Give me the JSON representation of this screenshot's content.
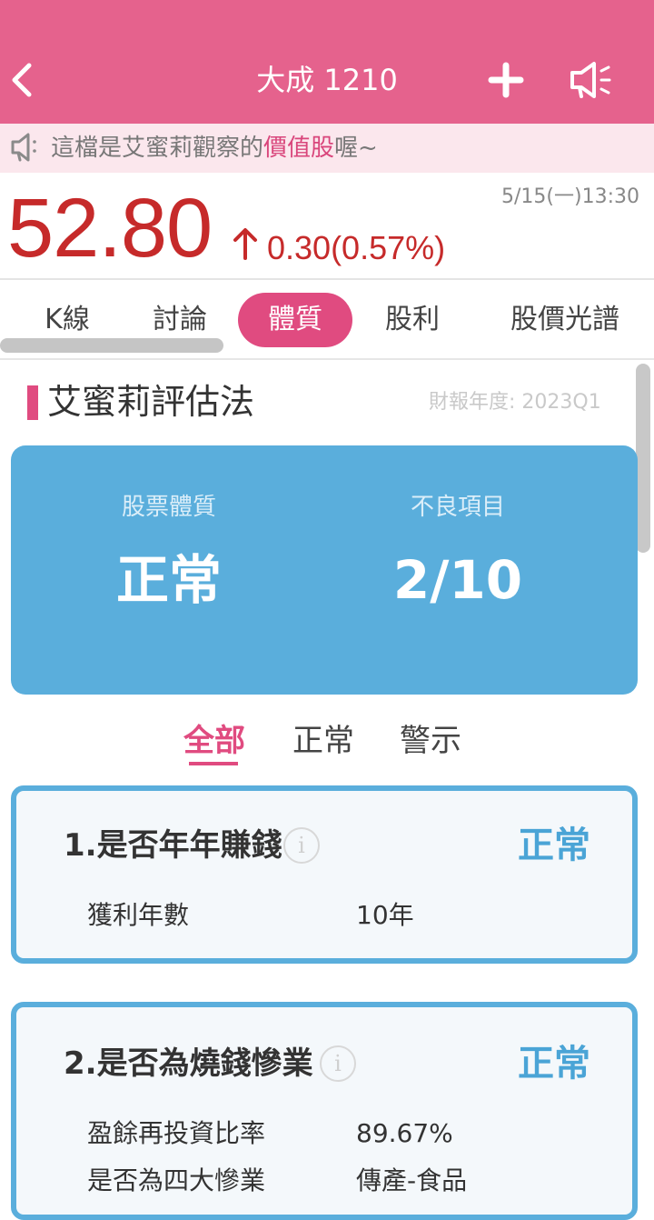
{
  "header": {
    "title": "大成 1210",
    "back_icon": "chevron-left-icon",
    "add_icon": "plus-icon",
    "share_icon": "megaphone-icon",
    "color": "#e5628d"
  },
  "notice": {
    "icon": "megaphone-icon",
    "text_before": "這檔是艾蜜莉觀察的",
    "highlight": "價值股",
    "text_after": "喔~"
  },
  "quote": {
    "price": "52.80",
    "direction": "up",
    "change": "0.30(0.57%)",
    "timestamp": "5/15(一)13:30",
    "color": "#c62a2a"
  },
  "tabs": [
    {
      "label": "K線",
      "active": false
    },
    {
      "label": "討論",
      "active": false
    },
    {
      "label": "體質",
      "active": true
    },
    {
      "label": "股利",
      "active": false
    },
    {
      "label": "股價光譜",
      "active": false
    }
  ],
  "section": {
    "title": "艾蜜莉評估法",
    "fiscal_label": "財報年度: 2023Q1"
  },
  "summary": {
    "health_label": "股票體質",
    "health_value": "正常",
    "bad_label": "不良項目",
    "bad_value": "2/10",
    "color": "#5aaedc"
  },
  "filters": [
    {
      "label": "全部",
      "active": true
    },
    {
      "label": "正常",
      "active": false
    },
    {
      "label": "警示",
      "active": false
    }
  ],
  "items": [
    {
      "title": "1.是否年年賺錢",
      "status": "正常",
      "rows": [
        {
          "label": "獲利年數",
          "value": "10年"
        }
      ]
    },
    {
      "title": "2.是否為燒錢慘業",
      "status": "正常",
      "rows": [
        {
          "label": "盈餘再投資比率",
          "value": "89.67%"
        },
        {
          "label": "是否為四大慘業",
          "value": "傳產-食品"
        }
      ]
    }
  ]
}
